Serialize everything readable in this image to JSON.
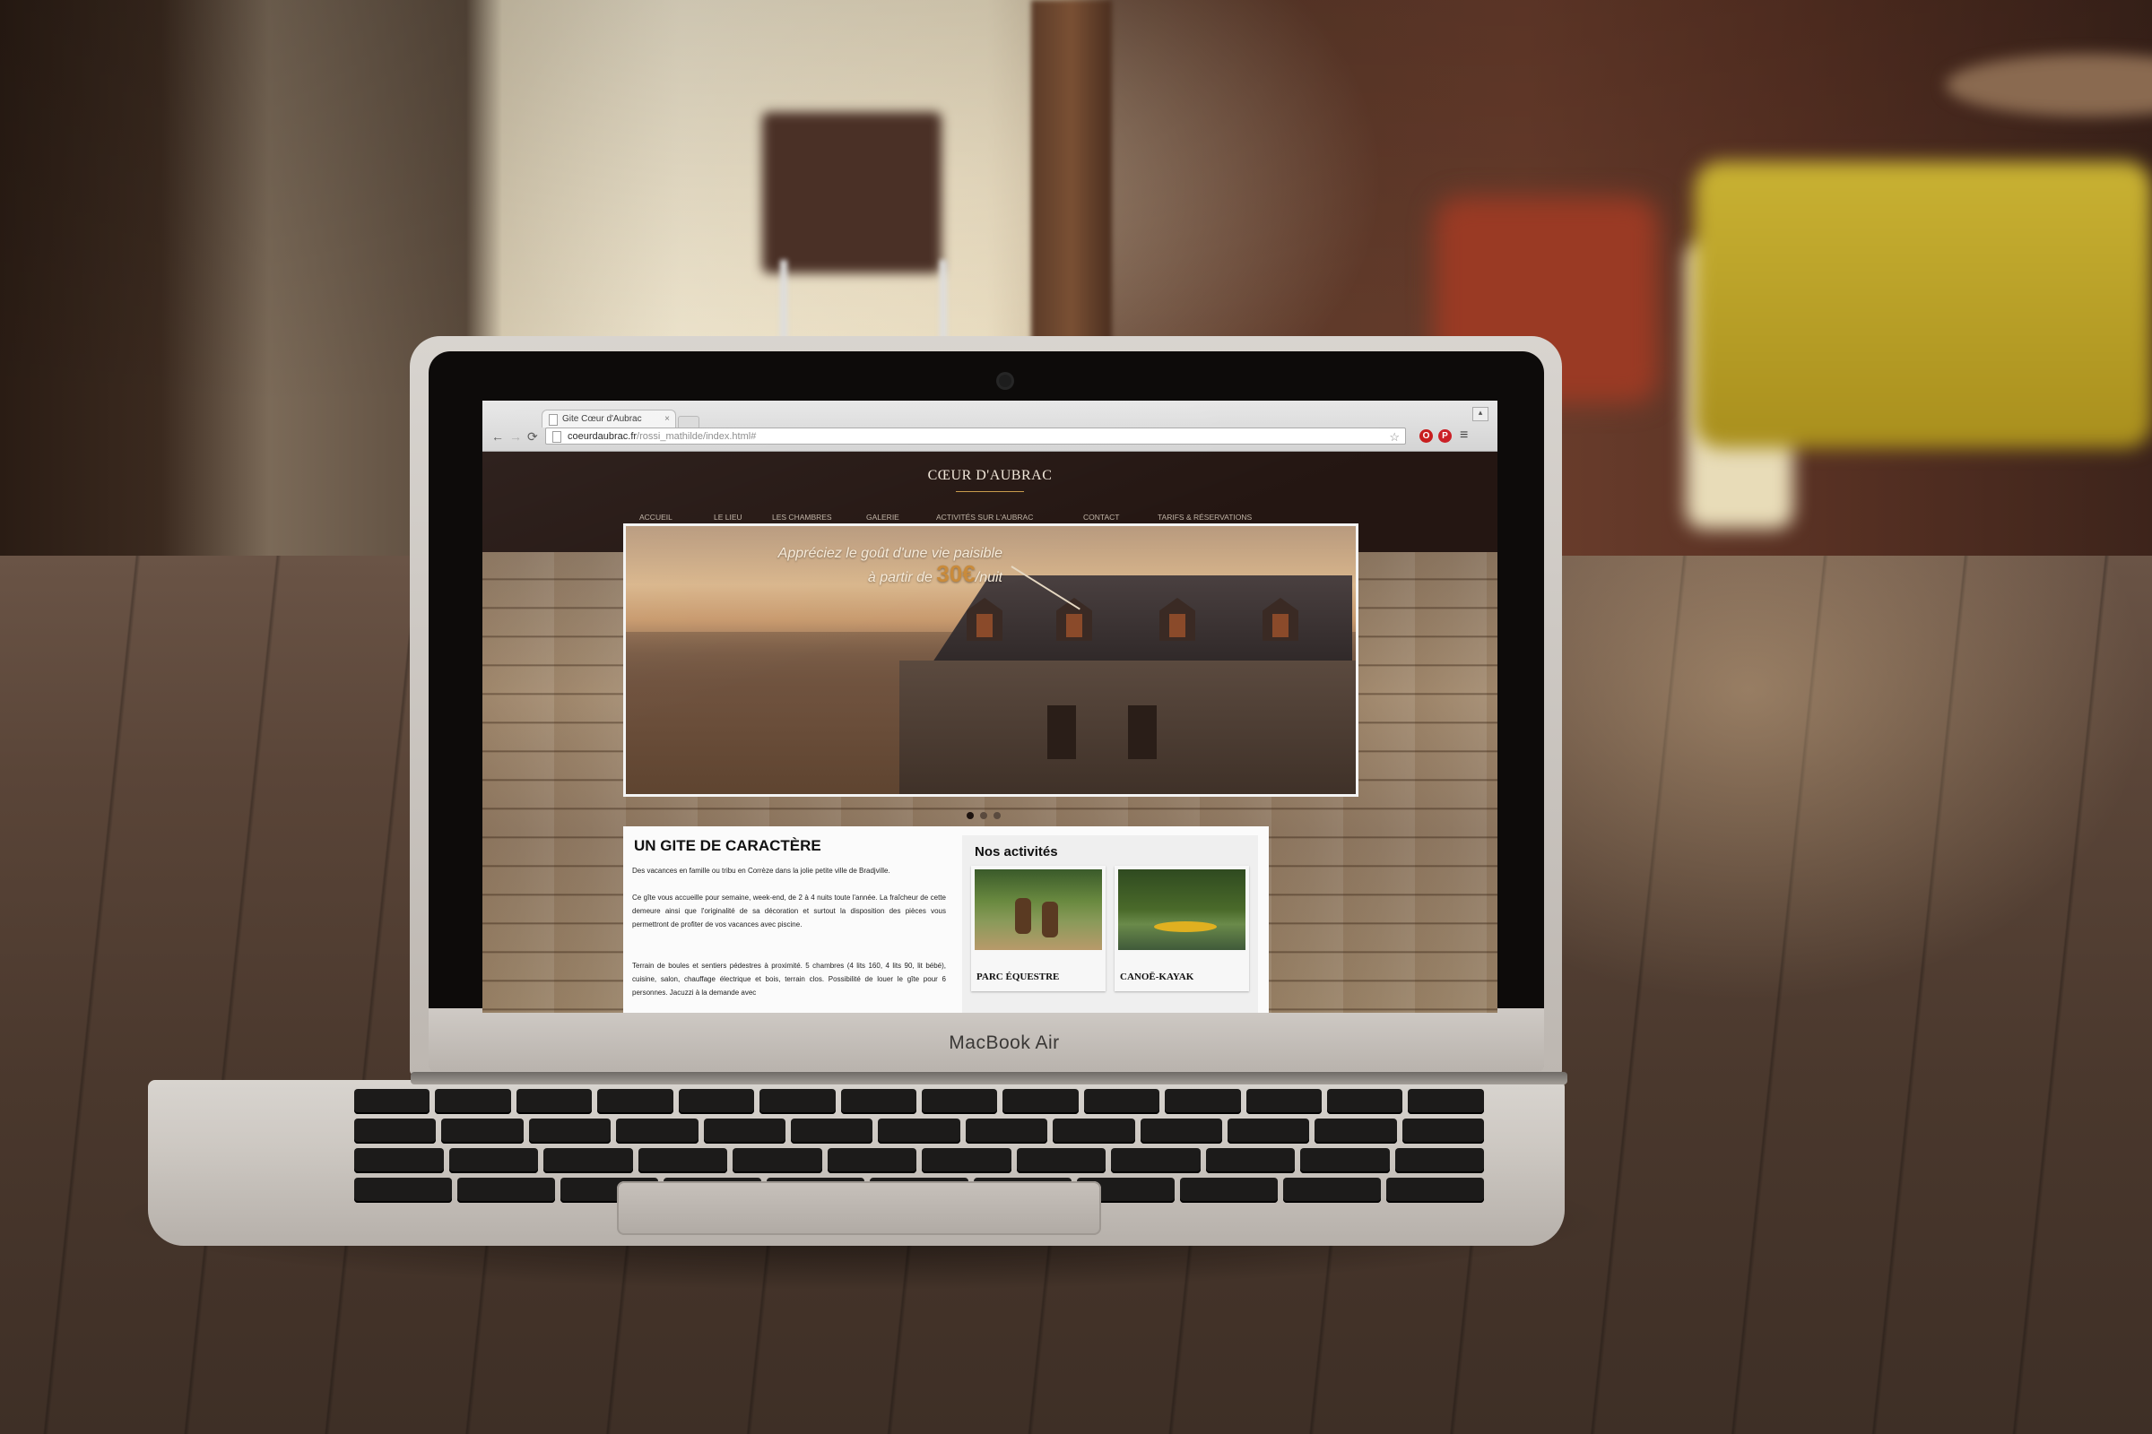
{
  "browser": {
    "tab_title": "Gite Cœur d'Aubrac",
    "tab_close": "×",
    "url_host": "coeurdaubrac.fr",
    "url_path": "/rossi_mathilde/index.html#",
    "back": "←",
    "forward": "→",
    "reload": "⟳",
    "star": "☆",
    "menu": "≡",
    "window_button": "▴",
    "ext_opera": "O",
    "ext_pin": "P"
  },
  "site": {
    "logo": "CŒUR D'AUBRAC",
    "nav": [
      "ACCUEIL",
      "LE LIEU",
      "LES CHAMBRES",
      "GALERIE",
      "ACTIVITÉS SUR L'AUBRAC",
      "CONTACT",
      "TARIFS & RÉSERVATIONS"
    ],
    "slider": {
      "tagline_line1": "Appréciez le goût d'une vie paisible",
      "tagline_line2_prefix": "à partir de",
      "price": "30€",
      "price_suffix": "/nuit",
      "slides": 3,
      "active_slide": 1
    },
    "intro": {
      "heading": "UN GITE DE CARACTÈRE",
      "p1": "Des vacances en famille ou tribu en Corrèze dans la jolie petite ville de Bradjville.",
      "p2": "Ce gîte vous accueille pour semaine, week-end, de 2 à 4 nuits toute l'année. La fraîcheur de cette demeure ainsi que l'originalité de sa décoration et surtout la disposition des pièces vous permettront de profiter de vos vacances avec piscine.",
      "p3": "Terrain de boules et sentiers pédestres à proximité. 5 chambres (4 lits 160, 4 lits 90, lit bébé), cuisine, salon, chauffage électrique et bois, terrain clos. Possibilité de louer le gîte pour 6 personnes. Jacuzzi à la demande avec"
    },
    "activities": {
      "title": "Nos activités",
      "items": [
        {
          "label": "PARC ÉQUESTRE"
        },
        {
          "label": "CANOË-KAYAK"
        }
      ]
    }
  },
  "device": {
    "brand": "MacBook Air"
  }
}
